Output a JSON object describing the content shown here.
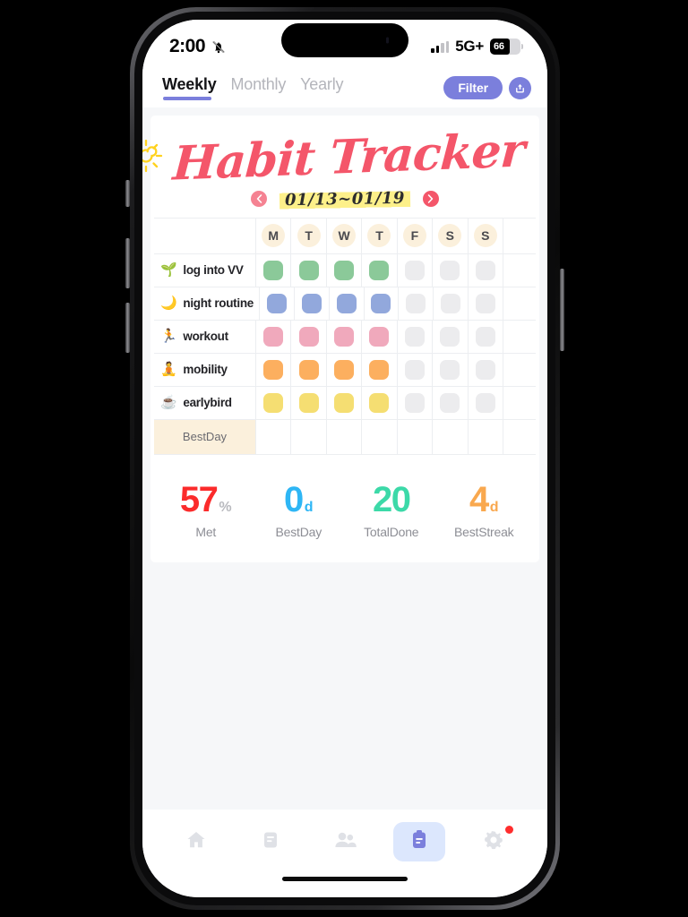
{
  "status_bar": {
    "time": "2:00",
    "bell_icon": "bell-slash-icon",
    "signal_icon": "cellular-bars-icon",
    "network": "5G+",
    "battery_level": "66"
  },
  "top_bar": {
    "tabs": [
      {
        "label": "Weekly",
        "active": true
      },
      {
        "label": "Monthly",
        "active": false
      },
      {
        "label": "Yearly",
        "active": false
      }
    ],
    "filter_label": "Filter",
    "share_icon": "share-upload-icon",
    "accent_color": "#7b7fdc"
  },
  "header": {
    "title": "Habit Tracker",
    "title_color": "#f4566a",
    "sun_icon": "sun-icon",
    "moon_icon": "moon-stars-icon",
    "comet_icon": "comet-icon"
  },
  "date_nav": {
    "prev_icon": "chevron-left-icon",
    "next_icon": "chevron-right-icon",
    "range": "01/13~01/19",
    "highlight_color": "#fdf08a",
    "arrow_color": "#f4566a"
  },
  "tracker": {
    "day_headers": [
      "M",
      "T",
      "W",
      "T",
      "F",
      "S",
      "S"
    ],
    "day_circle_color": "#fbf0dc",
    "empty_chip_color": "#ececee",
    "rows": [
      {
        "emoji": "🌱",
        "icon": "seedling-icon",
        "label": "log into VV",
        "color": "#8bc999",
        "done": [
          true,
          true,
          true,
          true,
          false,
          false,
          false
        ]
      },
      {
        "emoji": "🌙",
        "icon": "moon-icon",
        "label": "night routine",
        "color": "#92a8dc",
        "done": [
          true,
          true,
          true,
          true,
          false,
          false,
          false
        ]
      },
      {
        "emoji": "🏃",
        "icon": "runner-icon",
        "label": "workout",
        "color": "#f0a9bc",
        "done": [
          true,
          true,
          true,
          true,
          false,
          false,
          false
        ]
      },
      {
        "emoji": "🧘",
        "icon": "yoga-icon",
        "label": "mobility",
        "color": "#fcaf5f",
        "done": [
          true,
          true,
          true,
          true,
          false,
          false,
          false
        ]
      },
      {
        "emoji": "☕",
        "icon": "coffee-icon",
        "label": "earlybird",
        "color": "#f5de72",
        "done": [
          true,
          true,
          true,
          true,
          false,
          false,
          false
        ]
      }
    ],
    "bestday_row_label": "BestDay",
    "bestday_row_values": [
      "",
      "",
      "",
      "",
      "",
      "",
      ""
    ]
  },
  "stats": [
    {
      "value": "57",
      "unit": "%",
      "label": "Met",
      "color": "#fb2b2b"
    },
    {
      "value": "0",
      "unit": "d",
      "label": "BestDay",
      "color": "#2eb6f5"
    },
    {
      "value": "20",
      "unit": "",
      "label": "TotalDone",
      "color": "#3cd9a8"
    },
    {
      "value": "4",
      "unit": "d",
      "label": "BestStreak",
      "color": "#f9a84e"
    }
  ],
  "bottom_nav": {
    "items": [
      {
        "icon": "home-icon",
        "active": false,
        "badge": false
      },
      {
        "icon": "notes-icon",
        "active": false,
        "badge": false
      },
      {
        "icon": "people-icon",
        "active": false,
        "badge": false
      },
      {
        "icon": "clipboard-icon",
        "active": true,
        "badge": false
      },
      {
        "icon": "gear-icon",
        "active": false,
        "badge": true
      }
    ],
    "active_bg": "#dce7fd",
    "active_fg": "#7b7fdc",
    "inactive_fg": "#dfe1e6",
    "badge_color": "#ff2d2d"
  }
}
